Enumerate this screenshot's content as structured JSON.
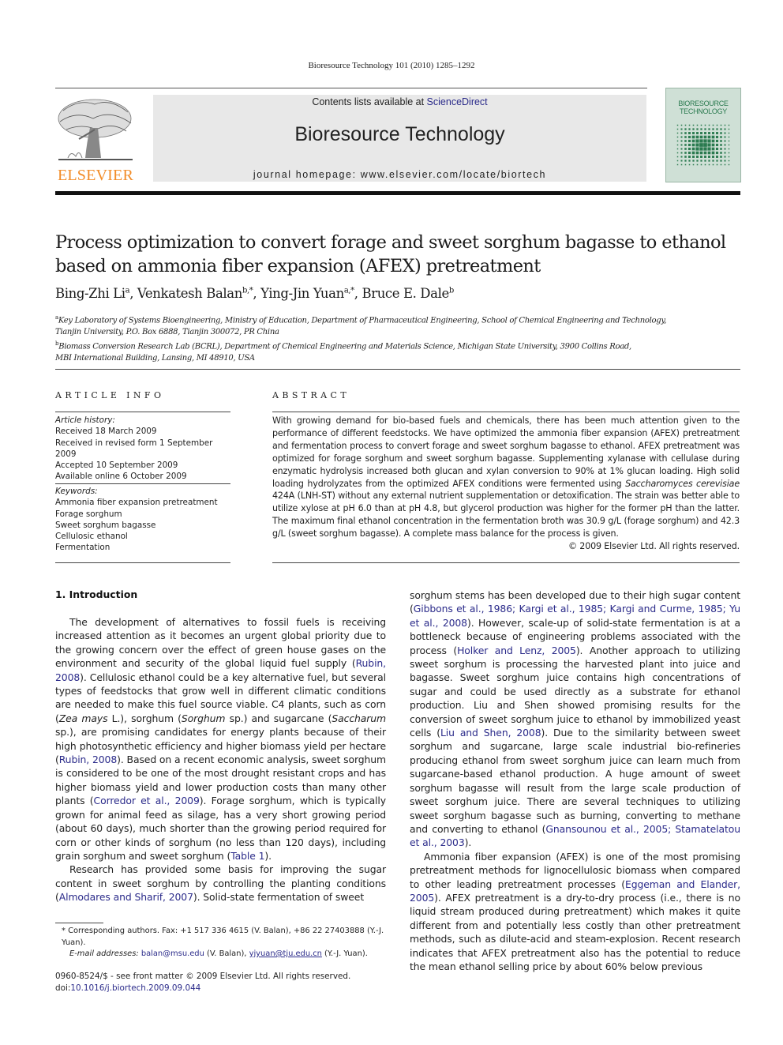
{
  "running_head": "Bioresource Technology 101 (2010) 1285–1292",
  "masthead": {
    "publisher_logo_text": "ELSEVIER",
    "contents_prefix": "Contents lists available at ",
    "contents_link": "ScienceDirect",
    "journal_title": "Bioresource Technology",
    "homepage": "journal homepage: www.elsevier.com/locate/biortech",
    "cover_title_line1": "BIORESOURCE",
    "cover_title_line2": "TECHNOLOGY",
    "colors": {
      "elsevier_orange": "#f28c28",
      "masthead_gray": "#e8e8e8",
      "cover_green": "#2a7a4f",
      "link_blue": "#2b2b8a"
    }
  },
  "article": {
    "title": "Process optimization to convert forage and sweet sorghum bagasse to ethanol based on ammonia fiber expansion (AFEX) pretreatment",
    "authors": [
      {
        "name": "Bing-Zhi Li",
        "sup": "a"
      },
      {
        "name": "Venkatesh Balan",
        "sup": "b,*"
      },
      {
        "name": "Ying-Jin Yuan",
        "sup": "a,*"
      },
      {
        "name": "Bruce E. Dale",
        "sup": "b"
      }
    ],
    "affiliations": [
      {
        "mark": "a",
        "line1": "Key Laboratory of Systems Bioengineering, Ministry of Education, Department of Pharmaceutical Engineering, School of Chemical Engineering and Technology,",
        "line2": "Tianjin University, P.O. Box 6888, Tianjin 300072, PR China"
      },
      {
        "mark": "b",
        "line1": "Biomass Conversion Research Lab (BCRL), Department of Chemical Engineering and Materials Science, Michigan State University, 3900 Collins Road,",
        "line2": "MBI International Building, Lansing, MI 48910, USA"
      }
    ]
  },
  "article_info": {
    "heading": "ARTICLE INFO",
    "history_label": "Article history:",
    "history": [
      "Received 18 March 2009",
      "Received in revised form 1 September 2009",
      "Accepted 10 September 2009",
      "Available online 6 October 2009"
    ],
    "keywords_label": "Keywords:",
    "keywords": [
      "Ammonia fiber expansion pretreatment",
      "Forage sorghum",
      "Sweet sorghum bagasse",
      "Cellulosic ethanol",
      "Fermentation"
    ]
  },
  "abstract": {
    "heading": "ABSTRACT",
    "text_part1": "With growing demand for bio-based fuels and chemicals, there has been much attention given to the performance of different feedstocks. We have optimized the ammonia fiber expansion (AFEX) pretreatment and fermentation process to convert forage and sweet sorghum bagasse to ethanol. AFEX pretreatment was optimized for forage sorghum and sweet sorghum bagasse. Supplementing xylanase with cellulase during enzymatic hydrolysis increased both glucan and xylan conversion to 90% at 1% glucan loading. High solid loading hydrolyzates from the optimized AFEX conditions were fermented using ",
    "species": "Saccharomyces cerevisiae",
    "text_part2": " 424A (LNH-ST) without any external nutrient supplementation or detoxification. The strain was better able to utilize xylose at pH 6.0 than at pH 4.8, but glycerol production was higher for the former pH than the latter. The maximum final ethanol concentration in the fermentation broth was 30.9 g/L (forage sorghum) and 42.3 g/L (sweet sorghum bagasse). A complete mass balance for the process is given.",
    "copyright": "© 2009 Elsevier Ltd. All rights reserved."
  },
  "introduction": {
    "heading": "1. Introduction",
    "left_col": {
      "p1": [
        {
          "t": "The development of alternatives to fossil fuels is receiving increased attention as it becomes an urgent global priority due to the growing concern over the effect of green house gases on the environment and security of the global liquid fuel supply ("
        },
        {
          "link": "Rubin, 2008"
        },
        {
          "t": "). Cellulosic ethanol could be a key alternative fuel, but several types of feedstocks that grow well in different climatic conditions are needed to make this fuel source viable. C4 plants, such as corn ("
        },
        {
          "i": "Zea mays"
        },
        {
          "t": " L.), sorghum ("
        },
        {
          "i": "Sorghum"
        },
        {
          "t": " sp.) and sugarcane ("
        },
        {
          "i": "Saccharum"
        },
        {
          "t": " sp.), are promising candidates for energy plants because of their high photosynthetic efficiency and higher biomass yield per hectare ("
        },
        {
          "link": "Rubin, 2008"
        },
        {
          "t": "). Based on a recent economic analysis, sweet sorghum is considered to be one of the most drought resistant crops and has higher biomass yield and lower production costs than many other plants ("
        },
        {
          "link": "Corredor et al., 2009"
        },
        {
          "t": "). Forage sorghum, which is typically grown for animal feed as silage, has a very short growing period (about 60 days), much shorter than the growing period required for corn or other kinds of sorghum (no less than 120 days), including grain sorghum and sweet sorghum ("
        },
        {
          "link": "Table 1"
        },
        {
          "t": ")."
        }
      ],
      "p2": [
        {
          "t": "Research has provided some basis for improving the sugar content in sweet sorghum by controlling the planting conditions ("
        },
        {
          "link": "Almodares and Sharif, 2007"
        },
        {
          "t": "). Solid-state fermentation of sweet"
        }
      ]
    },
    "right_col": {
      "p1": [
        {
          "t": "sorghum stems has been developed due to their high sugar content ("
        },
        {
          "link": "Gibbons et al., 1986; Kargi et al., 1985; Kargi and Curme, 1985; Yu et al., 2008"
        },
        {
          "t": "). However, scale-up of solid-state fermentation is at a bottleneck because of engineering problems associated with the process ("
        },
        {
          "link": "Holker and Lenz, 2005"
        },
        {
          "t": "). Another approach to utilizing sweet sorghum is processing the harvested plant into juice and bagasse. Sweet sorghum juice contains high concentrations of sugar and could be used directly as a substrate for ethanol production. Liu and Shen showed promising results for the conversion of sweet sorghum juice to ethanol by immobilized yeast cells ("
        },
        {
          "link": "Liu and Shen, 2008"
        },
        {
          "t": "). Due to the similarity between sweet sorghum and sugarcane, large scale industrial bio-refineries producing ethanol from sweet sorghum juice can learn much from sugarcane-based ethanol production. A huge amount of sweet sorghum bagasse will result from the large scale production of sweet sorghum juice. There are several techniques to utilizing sweet sorghum bagasse such as burning, converting to methane and converting to ethanol ("
        },
        {
          "link": "Gnansounou et al., 2005; Stamatelatou et al., 2003"
        },
        {
          "t": ")."
        }
      ],
      "p2": [
        {
          "t": "Ammonia fiber expansion (AFEX) is one of the most promising pretreatment methods for lignocellulosic biomass when compared to other leading pretreatment processes ("
        },
        {
          "link": "Eggeman and Elander, 2005"
        },
        {
          "t": "). AFEX pretreatment is a dry-to-dry process (i.e., there is no liquid stream produced during pretreatment) which makes it quite different from and potentially less costly than other pretreatment methods, such as dilute-acid and steam-explosion. Recent research indicates that AFEX pretreatment also has the potential to reduce the mean ethanol selling price by about 60% below previous"
        }
      ]
    }
  },
  "footnotes": {
    "corresponding": "* Corresponding authors. Fax: +1 517 336 4615 (V. Balan), +86 22 27403888 (Y.-J. Yuan).",
    "email_label": "E-mail addresses:",
    "email1": "balan@msu.edu",
    "email1_owner": " (V. Balan), ",
    "email2": "yjyuan@tju.edu.cn",
    "email2_owner": " (Y.-J. Yuan).",
    "front_matter": "0960-8524/$ - see front matter © 2009 Elsevier Ltd. All rights reserved.",
    "doi_prefix": "doi:",
    "doi": "10.1016/j.biortech.2009.09.044"
  }
}
